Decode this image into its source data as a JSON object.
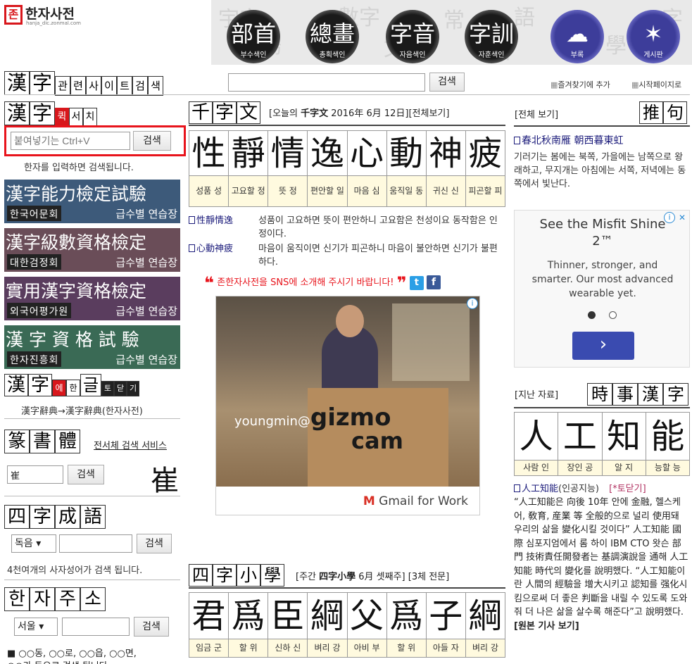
{
  "site": {
    "logo_mark": "존",
    "name": "한자사전",
    "url": "hanja_dic.zonmal.com"
  },
  "nav": [
    {
      "glyph": "部首",
      "caption": "부수색인"
    },
    {
      "glyph": "總畫",
      "caption": "총획색인"
    },
    {
      "glyph": "字音",
      "caption": "자음색인"
    },
    {
      "glyph": "字訓",
      "caption": "자훈색인"
    },
    {
      "glyph": "",
      "caption": "부록"
    },
    {
      "glyph": "",
      "caption": "게시판"
    }
  ],
  "related_search": {
    "tiles_big": [
      "漢",
      "字"
    ],
    "tiles_small": [
      "관",
      "련",
      "사",
      "이",
      "트",
      "검",
      "색"
    ],
    "button": "검색",
    "bookmark": "즐겨찾기에 추가",
    "homepage": "시작페이지로"
  },
  "quick": {
    "tiles": [
      "漢",
      "字"
    ],
    "red": "퀵",
    "small": [
      "서",
      "치"
    ],
    "placeholder": "붙여넣기는 Ctrl+V",
    "button": "검색",
    "help": "한자를 입력하면 검색됩니다."
  },
  "exams": [
    {
      "title": "漢字能力檢定試驗",
      "org": "한국어문회",
      "link": "급수별 연습장",
      "color": "#3d5a7a"
    },
    {
      "title": "漢字級數資格檢定",
      "org": "대한검정회",
      "link": "급수별 연습장",
      "color": "#6a4d58"
    },
    {
      "title": "實用漢字資格檢定",
      "org": "외국어평가원",
      "link": "급수별 연습장",
      "color": "#5a3d5e"
    },
    {
      "title": "漢 字 資 格 試 驗",
      "org": "한자진흥회",
      "link": "급수별 연습장",
      "color": "#3a6a55"
    }
  ],
  "dict_promo": {
    "tiles": [
      "漢",
      "字"
    ],
    "small": [
      "에",
      "한"
    ],
    "tail_tile": "글",
    "tail_small": [
      "토",
      "닫",
      "기"
    ],
    "caption": "漢字辭典→漢字辭典(한자사전)"
  },
  "seal": {
    "tiles": [
      "篆",
      "書",
      "體"
    ],
    "label": "전서체 검색 서비스",
    "value": "崔",
    "button": "검색",
    "preview": "崔"
  },
  "idiom": {
    "tiles": [
      "四",
      "字",
      "成",
      "語"
    ],
    "select": "독음 ▾",
    "button": "검색",
    "help": "4천여개의 사자성어가 검색 됩니다."
  },
  "address": {
    "tiles": [
      "한",
      "자",
      "주",
      "소"
    ],
    "select": "서울 ▾",
    "button": "검색",
    "help": "■ ○○동, ○○로, ○○읍, ○○면,",
    "help2": "○○가 등으로 검색 됩니다."
  },
  "thousand": {
    "tiles": [
      "千",
      "字",
      "文"
    ],
    "header_pre": "[오늘의 ",
    "header_bold": "千字文",
    "header_date": " 2016年 6月 12日]",
    "header_link": "[전체보기]",
    "chars": [
      "性",
      "靜",
      "情",
      "逸",
      "心",
      "動",
      "神",
      "疲"
    ],
    "means": [
      "성품 성",
      "고요할 정",
      "뜻 정",
      "편안할 일",
      "마음 심",
      "움직일 동",
      "귀신 신",
      "피곤할 피"
    ],
    "verses": [
      {
        "phrase": "性靜情逸",
        "text": "성품이 고요하면 뜻이 편안하니 고요함은 천성이요 동작함은 인정이다."
      },
      {
        "phrase": "心動神疲",
        "text": "마음이 움직이면 신기가 피곤하니 마음이 불안하면 신기가 불편하다."
      }
    ]
  },
  "sns": {
    "open": "❝",
    "text": "존한자사전을 SNS에 소개해 주시기 바랍니다!",
    "close": "❞",
    "t": "t",
    "f": "f"
  },
  "ad_center": {
    "info": "i",
    "brand1": "youngmin@",
    "brand2": "gizmo",
    "brand3": "cam",
    "footer": "Gmail for Work",
    "m": "M"
  },
  "sohak": {
    "tiles": [
      "四",
      "字",
      "小",
      "學"
    ],
    "header_pre": "[주간 ",
    "header_bold": "四字小學",
    "header_rest": " 6月 셋째주]",
    "header_link": "[3체 전문]",
    "chars": [
      "君",
      "爲",
      "臣",
      "綱",
      "父",
      "爲",
      "子",
      "綱"
    ],
    "means": [
      "임금 군",
      "할 위",
      "신하 신",
      "벼리 강",
      "아비 부",
      "할 위",
      "아들 자",
      "벼리 강"
    ]
  },
  "right_top": {
    "link": "[전체 보기]",
    "tiles": [
      "推",
      "句"
    ],
    "phrase": "春北秋南雁 朝西暮東虹",
    "text": "기러기는 봄에는 북쪽, 가을에는 남쪽으로 왕래하고, 무지개는 아침에는 서쪽, 저녁에는 동쪽에서 빛난다."
  },
  "ad_right": {
    "title": "See the Misfit Shine 2™",
    "body": "Thinner, stronger, and smarter. Our most advanced wearable yet.",
    "arrow": "›",
    "info": "i",
    "close": "✕"
  },
  "news": {
    "link": "[지난 자료]",
    "tiles": [
      "時",
      "事",
      "漢",
      "字"
    ],
    "chars": [
      "人",
      "工",
      "知",
      "能"
    ],
    "means": [
      "사람 인",
      "장인 공",
      "알 지",
      "능할 능"
    ],
    "headline": "人工知能",
    "headline_reading": "(인공지능)",
    "toggle": "[*토닫기]",
    "body": "“人工知能은 向後 10年 안에 金融, 헬스케어, 敎育, 産業 等 全般的으로 널리 使用돼 우리의 삶을 變化시킬 것이다” 人工知能 國際 심포지엄에서 롬 하이 IBM CTO 왓슨 部門 技術責任開發者는 基調演說을 通해 人工知能 時代의 變化를 說明했다. “人工知能이란 人間의 經驗을 增大시키고 認知를 强化시킴으로써 더 좋은 判斷을 내릴 수 있도록 도와줘 더 나은 삶을 살수록 해준다”고 說明했다.",
    "more": "[원본 기사 보기]"
  }
}
